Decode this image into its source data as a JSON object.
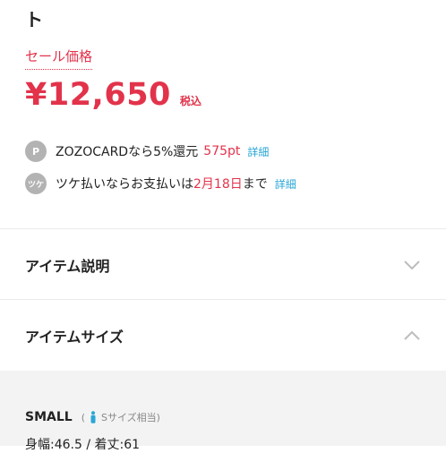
{
  "product": {
    "title_tail": "ト",
    "sale_label": "セール価格",
    "price": "¥12,650",
    "tax_label": "税込"
  },
  "zozocard": {
    "icon_letter": "P",
    "text": "ZOZOCARDなら5%還元",
    "points": "575pt",
    "detail_link": "詳細"
  },
  "tsuke": {
    "icon_text": "ツケ",
    "text_before": "ツケ払いならお支払いは",
    "date": "2月18日",
    "text_after": "まで",
    "detail_link": "詳細"
  },
  "sections": {
    "description_label": "アイテム説明",
    "size_label": "アイテムサイズ"
  },
  "size_detail": {
    "size_name": "SMALL",
    "paren_open": "(",
    "note": "Sサイズ相当)",
    "measurements": "身幅:46.5 / 着丈:61"
  },
  "colors": {
    "accent": "#e2334b",
    "link": "#2aa6d6",
    "icon_gray": "#b3b3b3",
    "panel_bg": "#f3f3f3"
  },
  "icons": [
    "points-icon",
    "tsuke-icon",
    "chevron-down-icon",
    "chevron-up-icon",
    "person-icon"
  ]
}
